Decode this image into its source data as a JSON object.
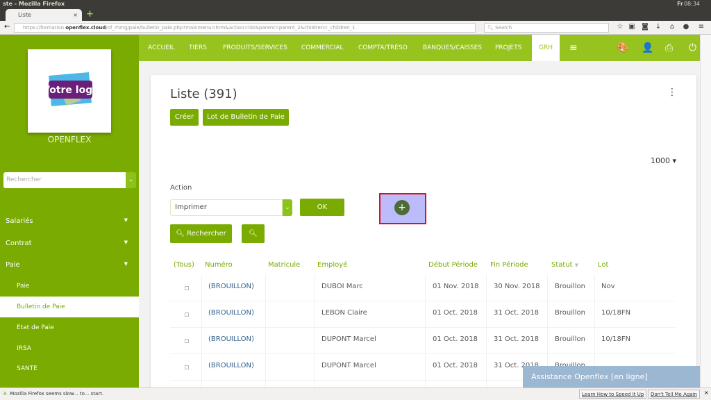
{
  "browser": {
    "window_title": "ste - Mozilla Firefox",
    "tab_title": "Liste",
    "url_prefix": "https://formation.",
    "url_domain": "openflex.cloud",
    "url_path": "/of_rhmg/paie/bulletin_paie.php?mainmenu=hrm&action=list&parent=parent_2&children=_children_1",
    "search_placeholder": "Search",
    "clock": "08:34",
    "lang": "Fr"
  },
  "sidebar": {
    "logo_text": "Votre logo",
    "brand": "OPENFLEX",
    "search_placeholder": "Rechercher",
    "items": [
      {
        "label": "Salariés"
      },
      {
        "label": "Contrat"
      },
      {
        "label": "Paie"
      }
    ],
    "subitems": [
      {
        "label": "Paie"
      },
      {
        "label": "Bulletin de Paie",
        "active": true
      },
      {
        "label": "Etat de Paie"
      },
      {
        "label": "IRSA"
      },
      {
        "label": "SANTE"
      }
    ]
  },
  "topnav": {
    "items": [
      "ACCUEIL",
      "TIERS",
      "PRODUITS/SERVICES",
      "COMMERCIAL",
      "COMPTA/TRÉSO",
      "BANQUES/CAISSES",
      "PROJETS",
      "GRH"
    ],
    "active": "GRH"
  },
  "main": {
    "title": "Liste (391)",
    "create_label": "Créer",
    "batch_label": "Lot de Bulletin de Paie",
    "per_page": "1000",
    "action_label": "Action",
    "action_value": "Imprimer",
    "ok_label": "OK",
    "search_label": "Rechercher"
  },
  "table": {
    "headers": [
      "(Tous)",
      "Numéro",
      "Matricule",
      "Employé",
      "Début Période",
      "Fin Période",
      "Statut",
      "Lot"
    ],
    "rows": [
      [
        "(BROUILLON)",
        "",
        "DUBOI Marc",
        "01 Nov. 2018",
        "30 Nov. 2018",
        "Brouillon",
        "Nov"
      ],
      [
        "(BROUILLON)",
        "",
        "LEBON Claire",
        "01 Oct. 2018",
        "31 Oct. 2018",
        "Brouillon",
        "10/18FN"
      ],
      [
        "(BROUILLON)",
        "",
        "DUPONT Marcel",
        "01 Oct. 2018",
        "31 Oct. 2018",
        "Brouillon",
        "10/18FN"
      ],
      [
        "(BROUILLON)",
        "",
        "DUPONT Marcel",
        "01 Oct. 2018",
        "31 Oct. 2018",
        "Brouillon",
        ""
      ]
    ]
  },
  "assist": "Assistance Openflex [en ligne]",
  "statusbar": {
    "message": "Mozilla Firefox seems slow... to... start.",
    "learn": "Learn How to Speed It Up",
    "dismiss": "Don't Tell Me Again"
  },
  "colors": {
    "sidebar": "#7aab00",
    "topnav": "#96c31e",
    "button": "#7aab00",
    "highlight": "#e0101a"
  }
}
